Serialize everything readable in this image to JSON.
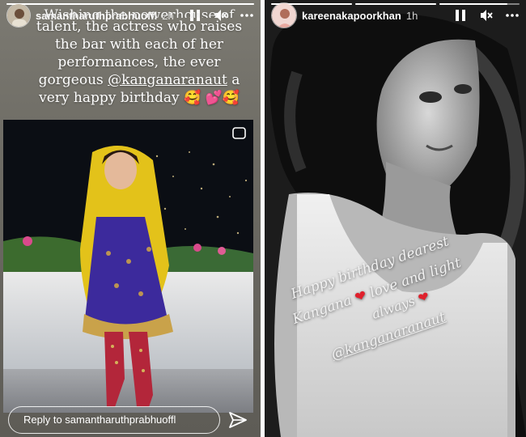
{
  "left_story": {
    "username": "samantharuthprabhuoffl",
    "time": "2h",
    "caption_lines": [
      "Wishing the powerhouse of",
      "talent, the actress who raises",
      "the bar with each of her",
      "performances, the ever",
      "gorgeous",
      "a",
      "very happy birthday 🥰 💕🥰"
    ],
    "mention": "@kanganaranaut",
    "reply_placeholder": "Reply to samantharuthprabhuoffl",
    "progress": [
      1.0
    ]
  },
  "right_story": {
    "username": "kareenakapoorkhan",
    "time": "1h",
    "progress": [
      1.0,
      1.0,
      0.85
    ],
    "handwritten_lines": [
      "Happy birthday dearest",
      "love and light",
      "always"
    ],
    "handwritten_name": "Kangana",
    "mention": "@kanganaranaut"
  },
  "icons": {
    "pause": "pause-icon",
    "mute": "speaker-muted-icon",
    "more": "more-options-icon",
    "send": "send-icon",
    "heart": "red-heart"
  }
}
